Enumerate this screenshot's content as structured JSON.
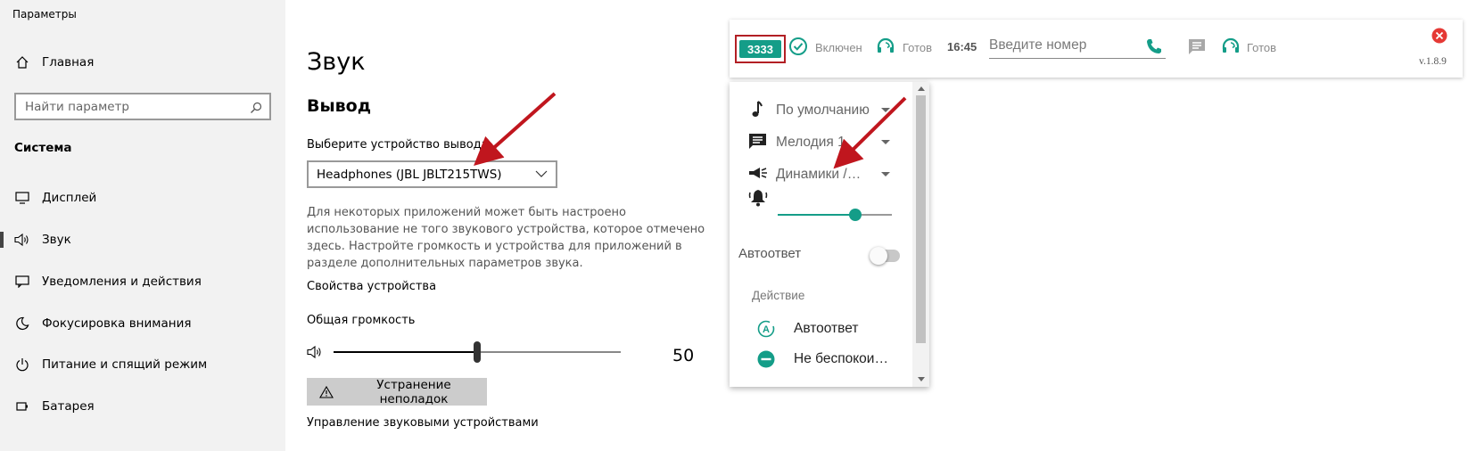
{
  "window": {
    "title": "Параметры"
  },
  "sidebar": {
    "home_label": "Главная",
    "search_placeholder": "Найти параметр",
    "section_label": "Система",
    "items": [
      {
        "label": "Дисплей",
        "icon": "monitor-icon"
      },
      {
        "label": "Звук",
        "icon": "speaker-icon",
        "active": true
      },
      {
        "label": "Уведомления и действия",
        "icon": "notification-icon"
      },
      {
        "label": "Фокусировка внимания",
        "icon": "moon-icon"
      },
      {
        "label": "Питание и спящий режим",
        "icon": "power-icon"
      },
      {
        "label": "Батарея",
        "icon": "battery-icon"
      }
    ]
  },
  "main": {
    "title": "Звук",
    "output_heading": "Вывод",
    "device_label": "Выберите устройство вывода",
    "device_value": "Headphones (JBL JBLT215TWS)",
    "description": "Для некоторых приложений может быть настроено использование не того звукового устройства, которое отмечено здесь. Настройте громкость и устройства для приложений в разделе дополнительных параметров звука.",
    "device_properties_link": "Свойства устройства",
    "master_volume_label": "Общая громкость",
    "volume_value": "50",
    "volume_percent": 50,
    "troubleshoot_label": "Устранение неполадок",
    "manage_devices_link": "Управление звуковыми устройствами"
  },
  "phone": {
    "extension": "3333",
    "status_enabled": "Включен",
    "status_ready": "Готов",
    "time": "16:45",
    "number_placeholder": "Введите номер",
    "agent_status": "Готов",
    "version": "v.1.8.9",
    "accent_color": "#149d88",
    "highlight_border_color": "#b21f24"
  },
  "panel": {
    "ringtone_value": "По умолчанию",
    "message_tone_value": "Мелодия 1",
    "speaker_value": "Динамики /…",
    "ring_volume_percent": 68,
    "autoanswer_label": "Автоответ",
    "autoanswer_enabled": false,
    "action_heading": "Действие",
    "actions": [
      {
        "label": "Автоответ",
        "icon": "autoanswer-icon"
      },
      {
        "label": "Не беспокои…",
        "icon": "do-not-disturb-icon"
      }
    ]
  }
}
